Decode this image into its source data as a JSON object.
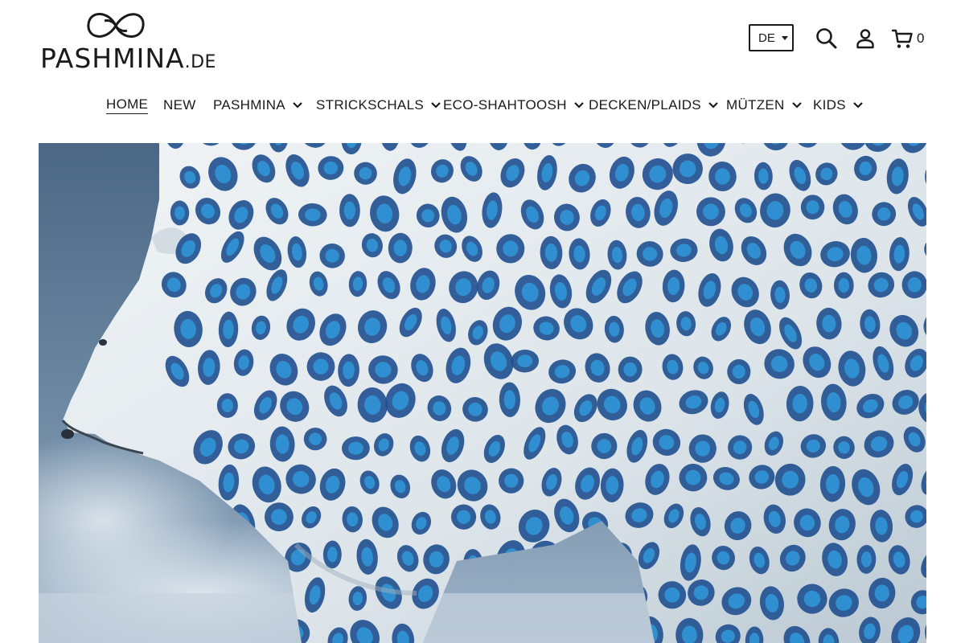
{
  "header": {
    "logo": {
      "wordmark": "PASHMINA",
      "suffix": ".DE"
    },
    "language_selector": {
      "selected": "DE"
    },
    "icons": {
      "search": "search-icon",
      "account": "user-icon",
      "cart": "cart-icon"
    },
    "cart_count": "0"
  },
  "nav": {
    "items": [
      {
        "label": "HOME",
        "active": true,
        "has_dropdown": false
      },
      {
        "label": "NEW",
        "active": false,
        "has_dropdown": false
      },
      {
        "label": "PASHMINA",
        "active": false,
        "has_dropdown": true
      },
      {
        "label": "STRICKSCHALS",
        "active": false,
        "has_dropdown": true
      },
      {
        "label": "ECO-SHAHTOOSH",
        "active": false,
        "has_dropdown": true
      },
      {
        "label": "DECKEN/PLAIDS",
        "active": false,
        "has_dropdown": true
      },
      {
        "label": "MÜTZEN",
        "active": false,
        "has_dropdown": true
      },
      {
        "label": "KIDS",
        "active": false,
        "has_dropdown": true
      }
    ]
  },
  "hero": {
    "subject": "polar bear with blue leopard-spotted fur",
    "colors": {
      "background": "#5b7894",
      "fur": "#e6ecef",
      "spot_dark": "#1f4f8f",
      "spot_light": "#2f8fd0"
    }
  }
}
